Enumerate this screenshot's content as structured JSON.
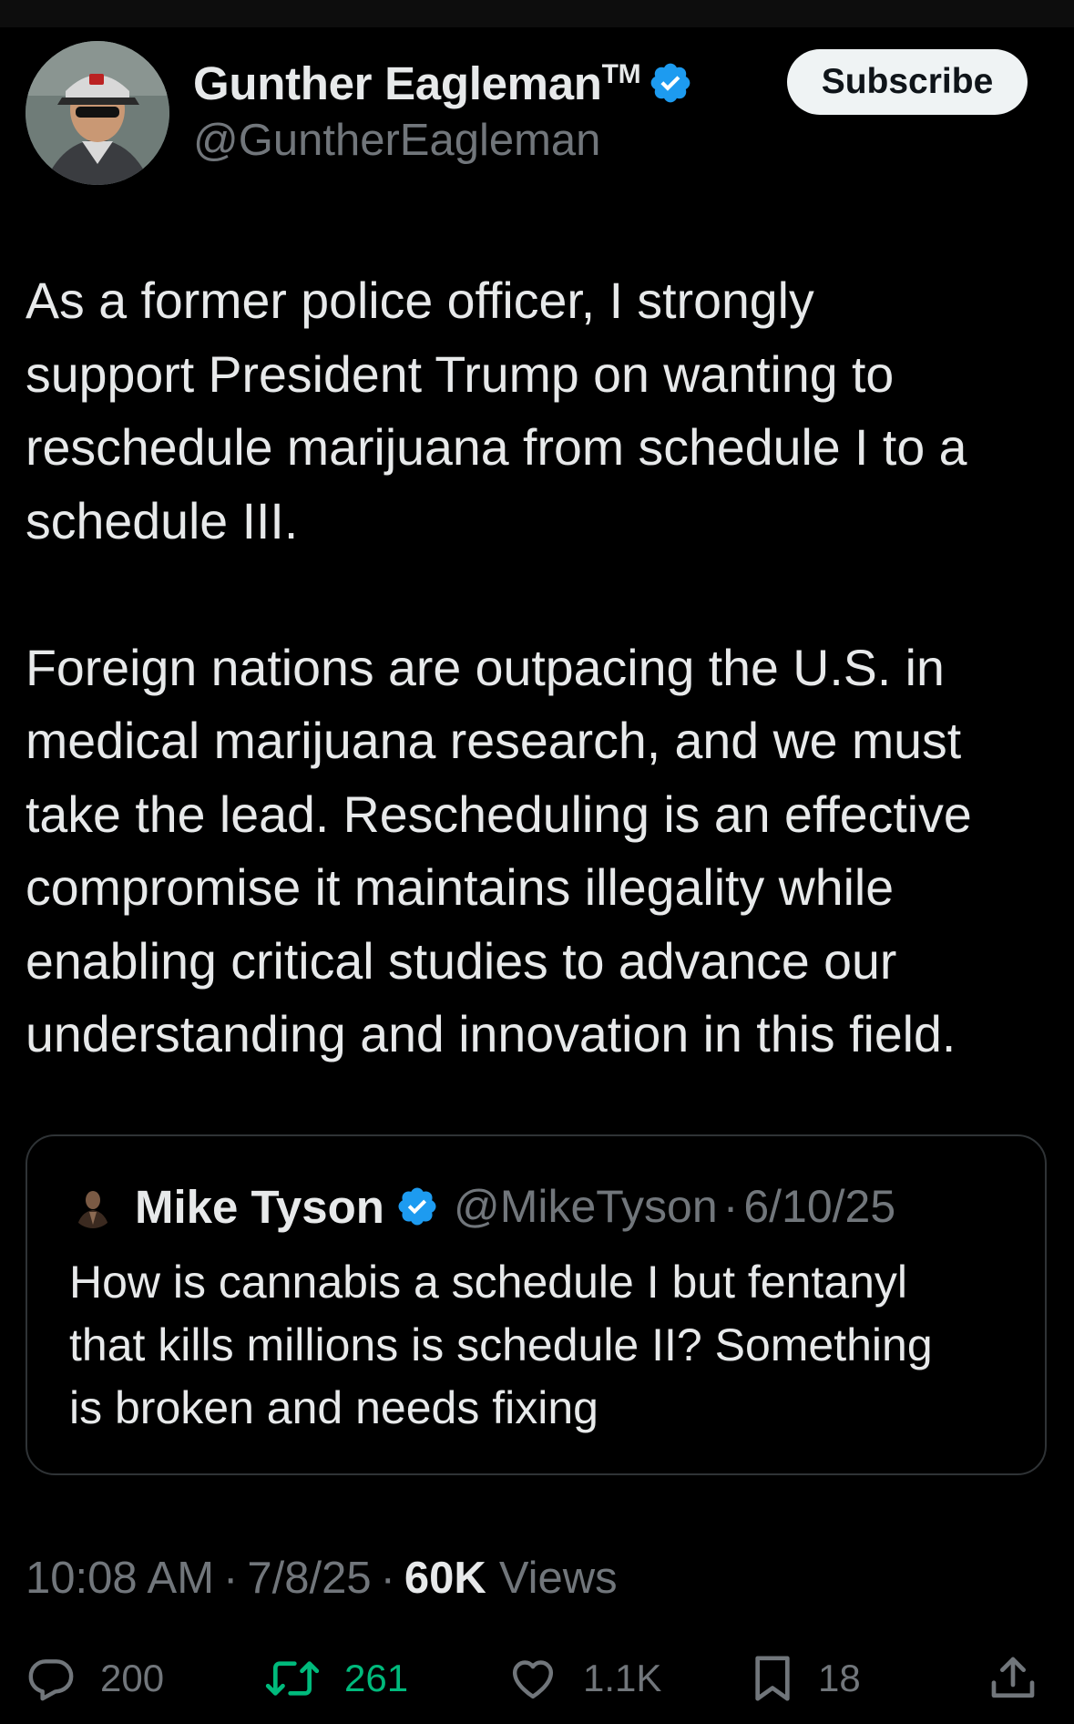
{
  "colors": {
    "background": "#000000",
    "text_primary": "#e7e9ea",
    "text_secondary": "#71767b",
    "verified_blue": "#1d9bf0",
    "retweet_green": "#00ba7c",
    "subscribe_bg": "#eff3f4"
  },
  "author": {
    "display_name": "Gunther Eagleman",
    "tm": "TM",
    "handle": "@GuntherEagleman",
    "verified_icon": "verified-badge-icon",
    "avatar": "avatar"
  },
  "subscribe_label": "Subscribe",
  "tweet": {
    "lines": [
      "As a former police officer, I strongly",
      "support President Trump on wanting to",
      "reschedule marijuana from schedule I to a",
      "schedule III.",
      "",
      "Foreign nations are outpacing the U.S. in",
      "medical marijuana research, and we must",
      "take the lead. Rescheduling is an effective",
      "compromise it maintains illegality while",
      "enabling critical studies to advance our",
      "understanding and innovation in this field."
    ]
  },
  "quote": {
    "name": "Mike Tyson",
    "handle": "@MikeTyson",
    "dot": "·",
    "date": "6/10/25",
    "lines": [
      "How is cannabis a schedule I but fentanyl",
      "that kills millions is schedule II? Something",
      "is broken and needs fixing"
    ]
  },
  "meta": {
    "time": "10:08 AM",
    "dot": "·",
    "date": "7/8/25",
    "views_count": "60K",
    "views_label": "Views"
  },
  "actions": {
    "reply": {
      "icon": "reply-icon",
      "count": "200"
    },
    "retweet": {
      "icon": "retweet-icon",
      "count": "261"
    },
    "like": {
      "icon": "heart-icon",
      "count": "1.1K"
    },
    "bookmark": {
      "icon": "bookmark-icon",
      "count": "18"
    },
    "share": {
      "icon": "share-icon"
    }
  }
}
